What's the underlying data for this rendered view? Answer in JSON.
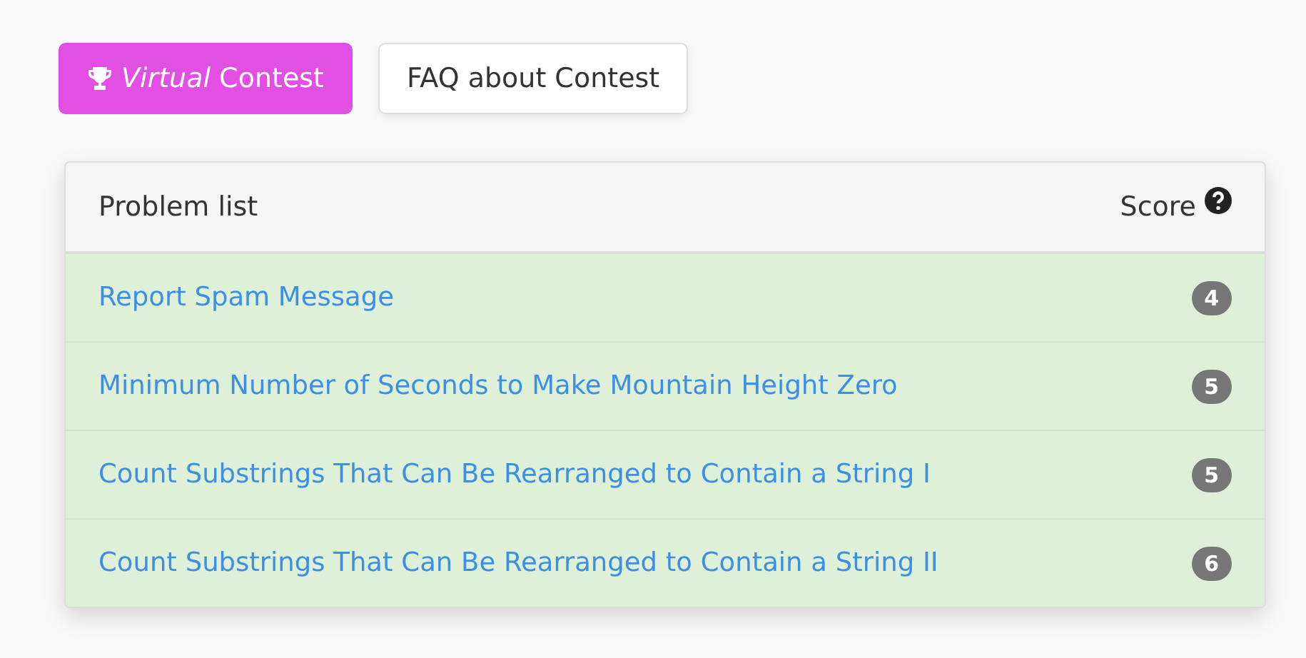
{
  "buttons": [
    {
      "kind": "primary",
      "label": "*Virtual* Contest"
    },
    {
      "kind": "default",
      "label": "FAQ about Contest"
    }
  ],
  "table": {
    "columns": [
      "Problem list",
      "Score"
    ],
    "rows": [
      {
        "title": "Report Spam Message",
        "score": "4",
        "solved": true
      },
      {
        "title": "Minimum Number of Seconds to Make Mountain Height Zero",
        "score": "5",
        "solved": true
      },
      {
        "title": "Count Substrings That Can Be Rearranged to Contain a String I",
        "score": "5",
        "solved": true
      },
      {
        "title": "Count Substrings That Can Be Rearranged to Contain a String II",
        "score": "6",
        "solved": true
      }
    ]
  }
}
